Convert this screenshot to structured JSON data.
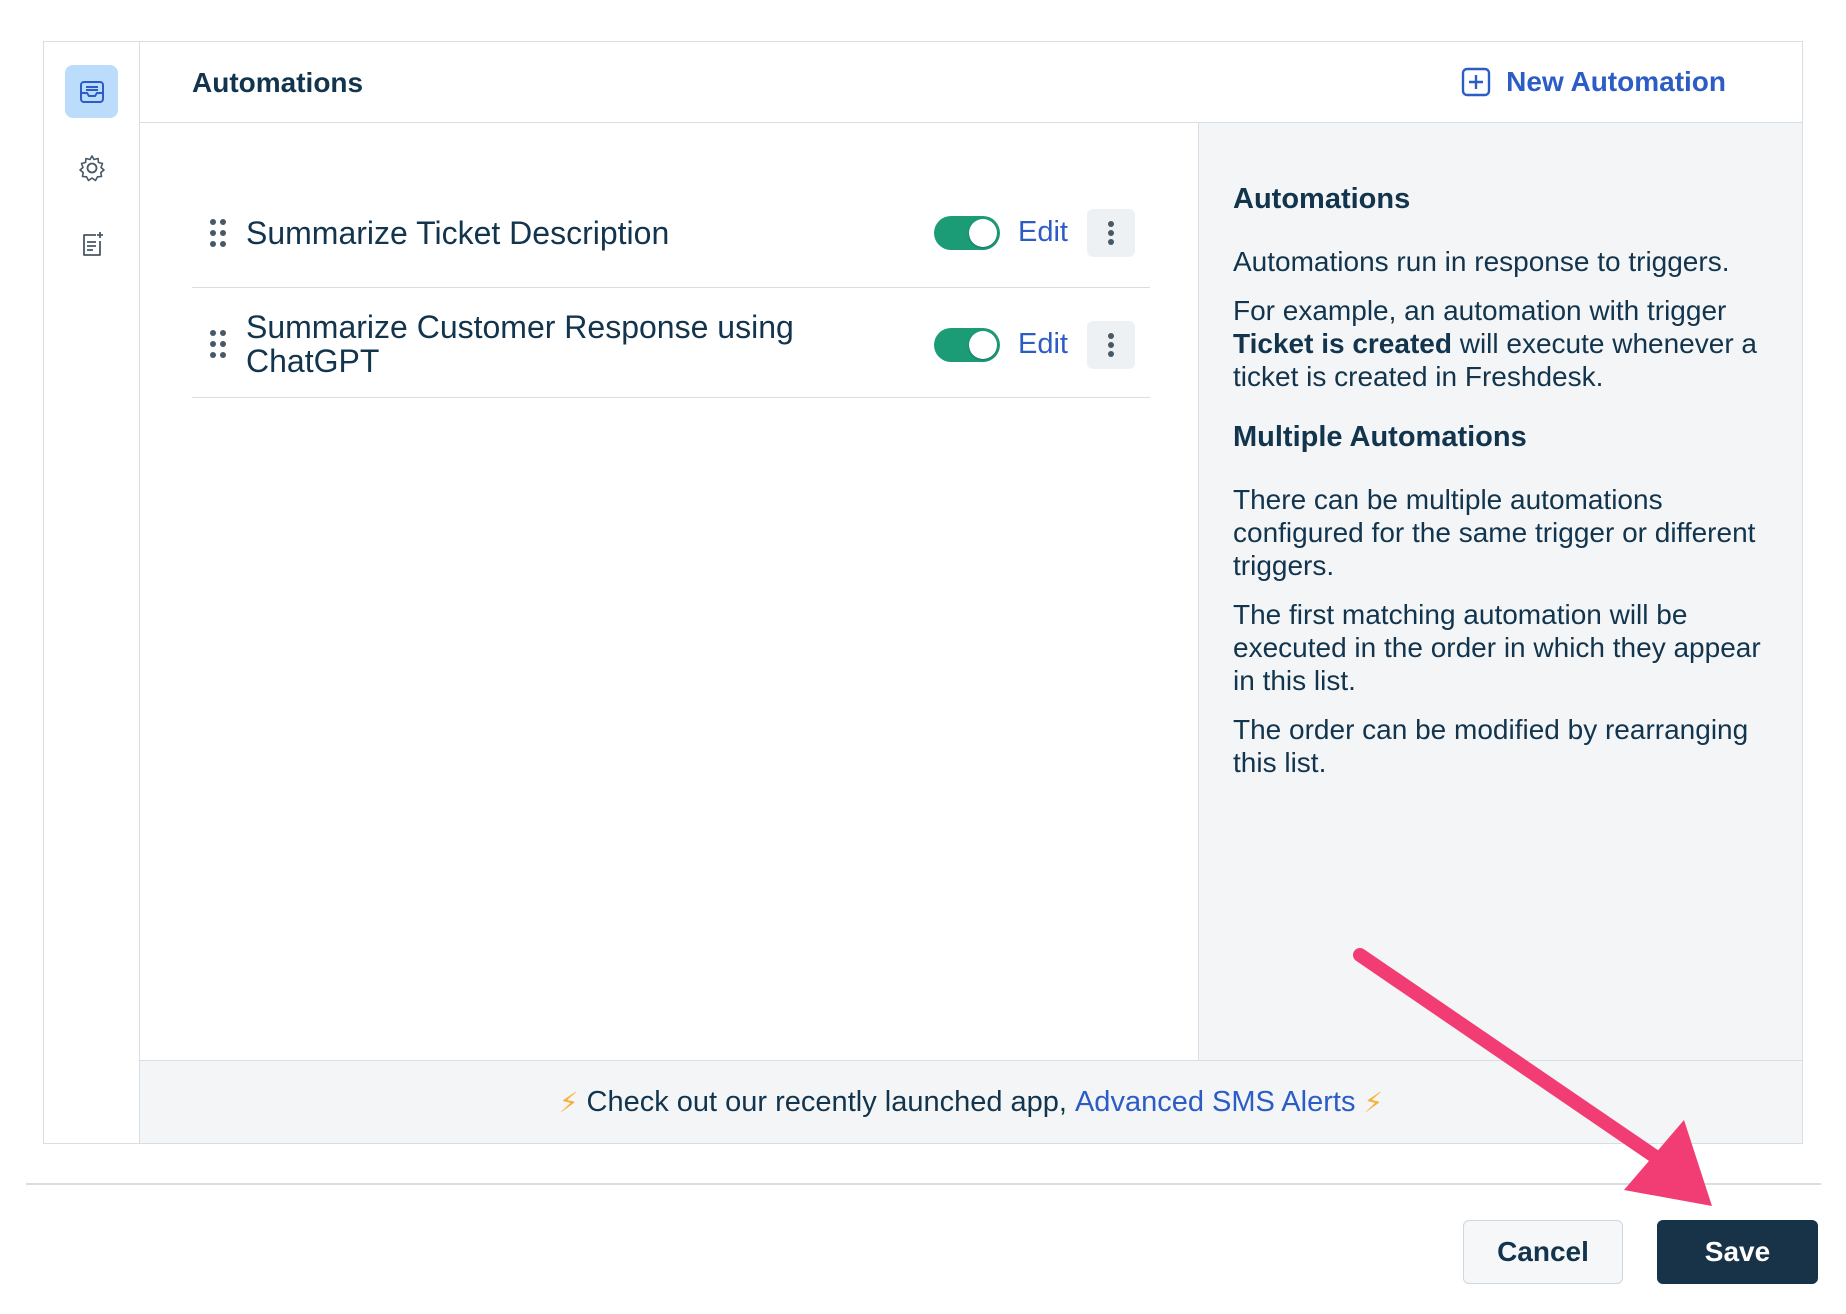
{
  "header": {
    "title": "Automations",
    "new_button_label": "New Automation"
  },
  "sidebar": {
    "items": [
      {
        "icon": "inbox-icon",
        "active": true
      },
      {
        "icon": "gear-icon",
        "active": false
      },
      {
        "icon": "document-edit-icon",
        "active": false
      }
    ]
  },
  "automations": {
    "items": [
      {
        "label": "Summarize Ticket Description",
        "enabled": true,
        "edit_label": "Edit"
      },
      {
        "label": "Summarize Customer Response using ChatGPT",
        "enabled": true,
        "edit_label": "Edit"
      }
    ]
  },
  "info": {
    "heading1": "Automations",
    "p1": "Automations run in response to triggers.",
    "p2_prefix": "For example, an automation with trigger ",
    "p2_bold": "Ticket is created",
    "p2_suffix": " will execute whenever a ticket is created in Freshdesk.",
    "heading2": "Multiple Automations",
    "p3": "There can be multiple automations configured for the same trigger or different triggers.",
    "p4": "The first matching automation will be executed in the order in which they appear in this list.",
    "p5": "The order can be modified by rearranging this list."
  },
  "banner": {
    "text": "Check out our recently launched app,",
    "link": "Advanced SMS Alerts",
    "bolt": "⚡"
  },
  "footer": {
    "cancel_label": "Cancel",
    "save_label": "Save"
  },
  "colors": {
    "accent": "#2c5cc5",
    "toggle_on": "#1c9b77",
    "save_bg": "#183247",
    "annotation_arrow": "#f23d74"
  }
}
